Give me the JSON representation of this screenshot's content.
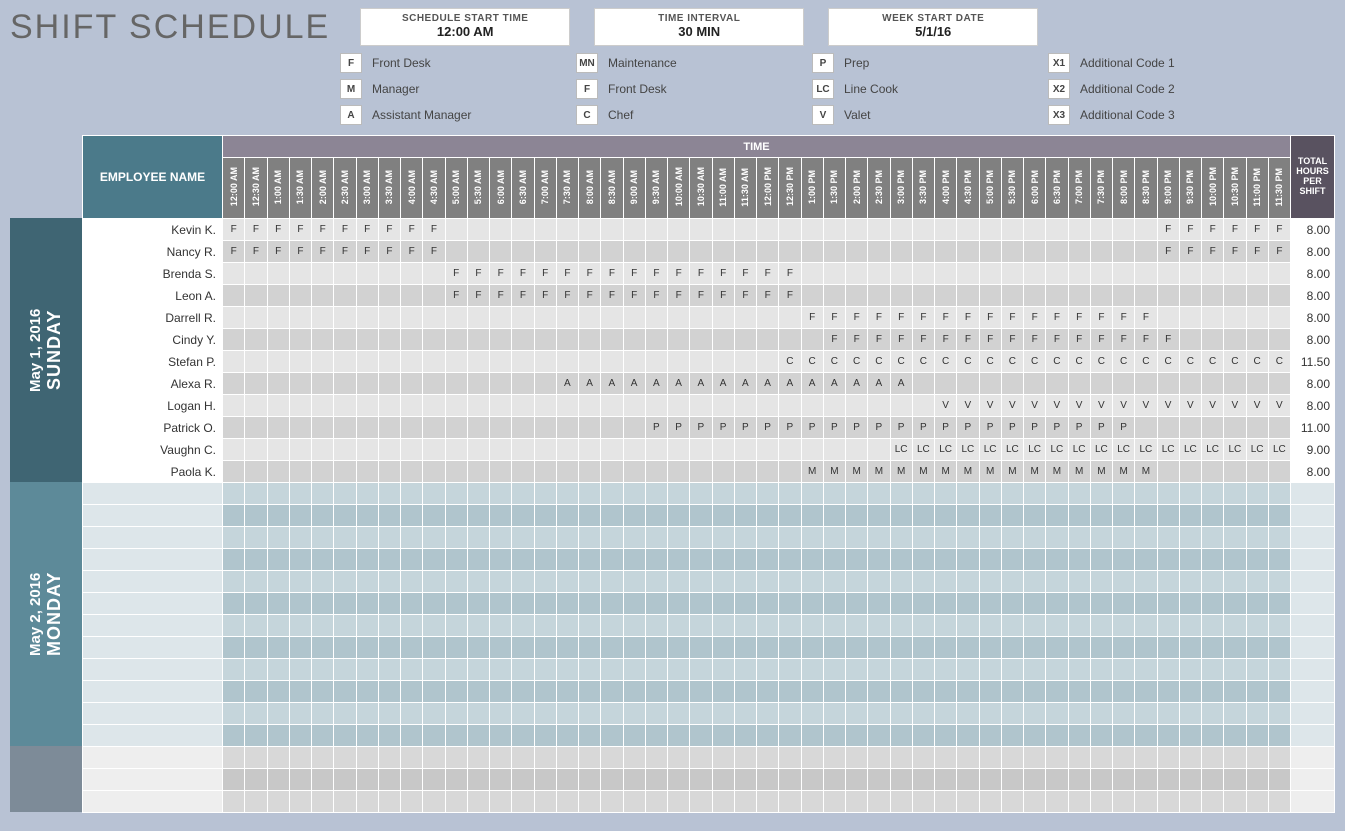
{
  "title": "SHIFT SCHEDULE",
  "config": {
    "start_time_label": "SCHEDULE START TIME",
    "start_time": "12:00 AM",
    "interval_label": "TIME INTERVAL",
    "interval": "30 MIN",
    "week_start_label": "WEEK START DATE",
    "week_start": "5/1/16"
  },
  "legend": [
    [
      {
        "code": "F",
        "label": "Front Desk"
      },
      {
        "code": "M",
        "label": "Manager"
      },
      {
        "code": "A",
        "label": "Assistant Manager"
      }
    ],
    [
      {
        "code": "MN",
        "label": "Maintenance"
      },
      {
        "code": "F",
        "label": "Front Desk"
      },
      {
        "code": "C",
        "label": "Chef"
      }
    ],
    [
      {
        "code": "P",
        "label": "Prep"
      },
      {
        "code": "LC",
        "label": "Line Cook"
      },
      {
        "code": "V",
        "label": "Valet"
      }
    ],
    [
      {
        "code": "X1",
        "label": "Additional Code 1"
      },
      {
        "code": "X2",
        "label": "Additional Code 2"
      },
      {
        "code": "X3",
        "label": "Additional Code 3"
      }
    ]
  ],
  "headers": {
    "employee": "EMPLOYEE NAME",
    "time_banner": "TIME",
    "total": "TOTAL HOURS PER SHIFT"
  },
  "time_slots": [
    "12:00 AM",
    "12:30 AM",
    "1:00 AM",
    "1:30 AM",
    "2:00 AM",
    "2:30 AM",
    "3:00 AM",
    "3:30 AM",
    "4:00 AM",
    "4:30 AM",
    "5:00 AM",
    "5:30 AM",
    "6:00 AM",
    "6:30 AM",
    "7:00 AM",
    "7:30 AM",
    "8:00 AM",
    "8:30 AM",
    "9:00 AM",
    "9:30 AM",
    "10:00 AM",
    "10:30 AM",
    "11:00 AM",
    "11:30 AM",
    "12:00 PM",
    "12:30 PM",
    "1:00 PM",
    "1:30 PM",
    "2:00 PM",
    "2:30 PM",
    "3:00 PM",
    "3:30 PM",
    "4:00 PM",
    "4:30 PM",
    "5:00 PM",
    "5:30 PM",
    "6:00 PM",
    "6:30 PM",
    "7:00 PM",
    "7:30 PM",
    "8:00 PM",
    "8:30 PM",
    "9:00 PM",
    "9:30 PM",
    "10:00 PM",
    "10:30 PM",
    "11:00 PM",
    "11:30 PM"
  ],
  "days": [
    {
      "name": "SUNDAY",
      "date": "May 1, 2016",
      "class": "day-sunday",
      "row_class": "",
      "rows": [
        {
          "name": "Kevin K.",
          "total": "8.00",
          "cells": {
            "0": "F",
            "1": "F",
            "2": "F",
            "3": "F",
            "4": "F",
            "5": "F",
            "6": "F",
            "7": "F",
            "8": "F",
            "9": "F",
            "42": "F",
            "43": "F",
            "44": "F",
            "45": "F",
            "46": "F",
            "47": "F"
          }
        },
        {
          "name": "Nancy R.",
          "total": "8.00",
          "cells": {
            "0": "F",
            "1": "F",
            "2": "F",
            "3": "F",
            "4": "F",
            "5": "F",
            "6": "F",
            "7": "F",
            "8": "F",
            "9": "F",
            "42": "F",
            "43": "F",
            "44": "F",
            "45": "F",
            "46": "F",
            "47": "F"
          }
        },
        {
          "name": "Brenda S.",
          "total": "8.00",
          "cells": {
            "10": "F",
            "11": "F",
            "12": "F",
            "13": "F",
            "14": "F",
            "15": "F",
            "16": "F",
            "17": "F",
            "18": "F",
            "19": "F",
            "20": "F",
            "21": "F",
            "22": "F",
            "23": "F",
            "24": "F",
            "25": "F"
          }
        },
        {
          "name": "Leon A.",
          "total": "8.00",
          "cells": {
            "10": "F",
            "11": "F",
            "12": "F",
            "13": "F",
            "14": "F",
            "15": "F",
            "16": "F",
            "17": "F",
            "18": "F",
            "19": "F",
            "20": "F",
            "21": "F",
            "22": "F",
            "23": "F",
            "24": "F",
            "25": "F"
          }
        },
        {
          "name": "Darrell R.",
          "total": "8.00",
          "cells": {
            "26": "F",
            "27": "F",
            "28": "F",
            "29": "F",
            "30": "F",
            "31": "F",
            "32": "F",
            "33": "F",
            "34": "F",
            "35": "F",
            "36": "F",
            "37": "F",
            "38": "F",
            "39": "F",
            "40": "F",
            "41": "F"
          }
        },
        {
          "name": "Cindy Y.",
          "total": "8.00",
          "cells": {
            "27": "F",
            "28": "F",
            "29": "F",
            "30": "F",
            "31": "F",
            "32": "F",
            "33": "F",
            "34": "F",
            "35": "F",
            "36": "F",
            "37": "F",
            "38": "F",
            "39": "F",
            "40": "F",
            "41": "F",
            "42": "F"
          }
        },
        {
          "name": "Stefan P.",
          "total": "11.50",
          "cells": {
            "25": "C",
            "26": "C",
            "27": "C",
            "28": "C",
            "29": "C",
            "30": "C",
            "31": "C",
            "32": "C",
            "33": "C",
            "34": "C",
            "35": "C",
            "36": "C",
            "37": "C",
            "38": "C",
            "39": "C",
            "40": "C",
            "41": "C",
            "42": "C",
            "43": "C",
            "44": "C",
            "45": "C",
            "46": "C",
            "47": "C"
          }
        },
        {
          "name": "Alexa R.",
          "total": "8.00",
          "cells": {
            "15": "A",
            "16": "A",
            "17": "A",
            "18": "A",
            "19": "A",
            "20": "A",
            "21": "A",
            "22": "A",
            "23": "A",
            "24": "A",
            "25": "A",
            "26": "A",
            "27": "A",
            "28": "A",
            "29": "A",
            "30": "A"
          }
        },
        {
          "name": "Logan H.",
          "total": "8.00",
          "cells": {
            "32": "V",
            "33": "V",
            "34": "V",
            "35": "V",
            "36": "V",
            "37": "V",
            "38": "V",
            "39": "V",
            "40": "V",
            "41": "V",
            "42": "V",
            "43": "V",
            "44": "V",
            "45": "V",
            "46": "V",
            "47": "V"
          }
        },
        {
          "name": "Patrick O.",
          "total": "11.00",
          "cells": {
            "19": "P",
            "20": "P",
            "21": "P",
            "22": "P",
            "23": "P",
            "24": "P",
            "25": "P",
            "26": "P",
            "27": "P",
            "28": "P",
            "29": "P",
            "30": "P",
            "31": "P",
            "32": "P",
            "33": "P",
            "34": "P",
            "35": "P",
            "36": "P",
            "37": "P",
            "38": "P",
            "39": "P",
            "40": "P"
          }
        },
        {
          "name": "Vaughn C.",
          "total": "9.00",
          "cells": {
            "30": "LC",
            "31": "LC",
            "32": "LC",
            "33": "LC",
            "34": "LC",
            "35": "LC",
            "36": "LC",
            "37": "LC",
            "38": "LC",
            "39": "LC",
            "40": "LC",
            "41": "LC",
            "42": "LC",
            "43": "LC",
            "44": "LC",
            "45": "LC",
            "46": "LC",
            "47": "LC"
          }
        },
        {
          "name": "Paola K.",
          "total": "8.00",
          "cells": {
            "26": "M",
            "27": "M",
            "28": "M",
            "29": "M",
            "30": "M",
            "31": "M",
            "32": "M",
            "33": "M",
            "34": "M",
            "35": "M",
            "36": "M",
            "37": "M",
            "38": "M",
            "39": "M",
            "40": "M",
            "41": "M"
          }
        }
      ]
    },
    {
      "name": "MONDAY",
      "date": "May 2, 2016",
      "class": "day-monday",
      "row_class": "row-mon",
      "rows": [
        {
          "name": "",
          "total": "",
          "cells": {}
        },
        {
          "name": "",
          "total": "",
          "cells": {}
        },
        {
          "name": "",
          "total": "",
          "cells": {}
        },
        {
          "name": "",
          "total": "",
          "cells": {}
        },
        {
          "name": "",
          "total": "",
          "cells": {}
        },
        {
          "name": "",
          "total": "",
          "cells": {}
        },
        {
          "name": "",
          "total": "",
          "cells": {}
        },
        {
          "name": "",
          "total": "",
          "cells": {}
        },
        {
          "name": "",
          "total": "",
          "cells": {}
        },
        {
          "name": "",
          "total": "",
          "cells": {}
        },
        {
          "name": "",
          "total": "",
          "cells": {}
        },
        {
          "name": "",
          "total": "",
          "cells": {}
        }
      ]
    },
    {
      "name": "",
      "date": "",
      "class": "day-tuesday",
      "row_class": "row-tue",
      "rows": [
        {
          "name": "",
          "total": "",
          "cells": {}
        },
        {
          "name": "",
          "total": "",
          "cells": {}
        },
        {
          "name": "",
          "total": "",
          "cells": {}
        }
      ]
    }
  ]
}
